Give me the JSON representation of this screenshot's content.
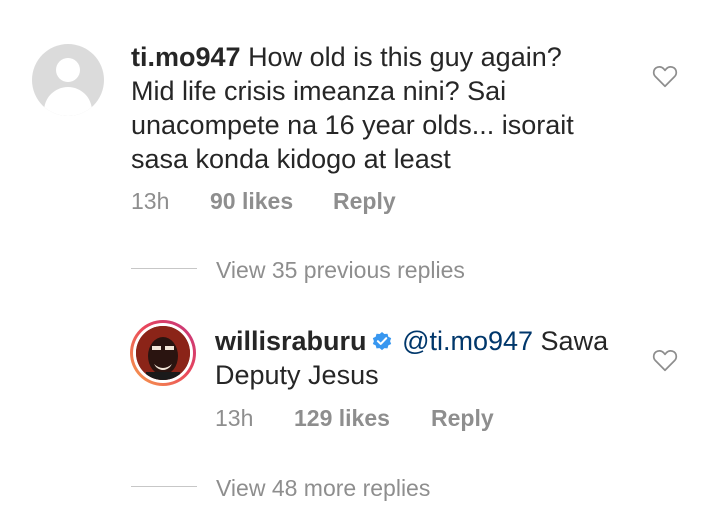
{
  "comments": [
    {
      "username": "ti.mo947",
      "text": "How old is this guy again? Mid life crisis imeanza nini? Sai unacompete na 16 year olds... isorait sasa konda kidogo at least",
      "time": "13h",
      "likes": "90 likes",
      "reply_label": "Reply",
      "view_replies": "View 35 previous replies"
    },
    {
      "username": "willisraburu",
      "mention": "@ti.mo947",
      "text": "Sawa Deputy Jesus",
      "time": "13h",
      "likes": "129 likes",
      "reply_label": "Reply",
      "view_replies": "View 48 more replies"
    }
  ],
  "icons": {
    "heart": "heart-outline-icon",
    "verified": "verified-badge-icon",
    "default_avatar": "default-avatar-icon"
  },
  "colors": {
    "text": "#262626",
    "secondary": "#8e8e8e",
    "verified": "#3897f0",
    "mention": "#00376b"
  }
}
